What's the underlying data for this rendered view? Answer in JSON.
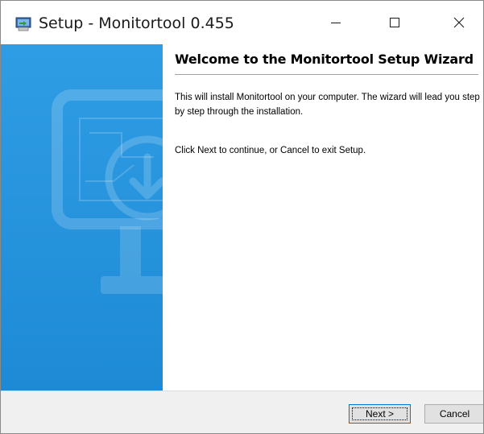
{
  "window": {
    "title": "Setup - Monitortool 0.455",
    "icons": {
      "app": "setup-installer-icon",
      "minimize": "minimize-icon",
      "maximize": "maximize-icon",
      "close": "close-icon"
    }
  },
  "sidebar": {
    "image": "monitor-download-graphic",
    "color": "#2196e0"
  },
  "content": {
    "heading": "Welcome to the Monitortool Setup Wizard",
    "paragraph1": "This will install Monitortool on your computer. The wizard will lead you step by step through the installation.",
    "paragraph2": "Click Next to continue, or Cancel to exit Setup."
  },
  "buttons": {
    "next": "Next >",
    "cancel": "Cancel"
  }
}
